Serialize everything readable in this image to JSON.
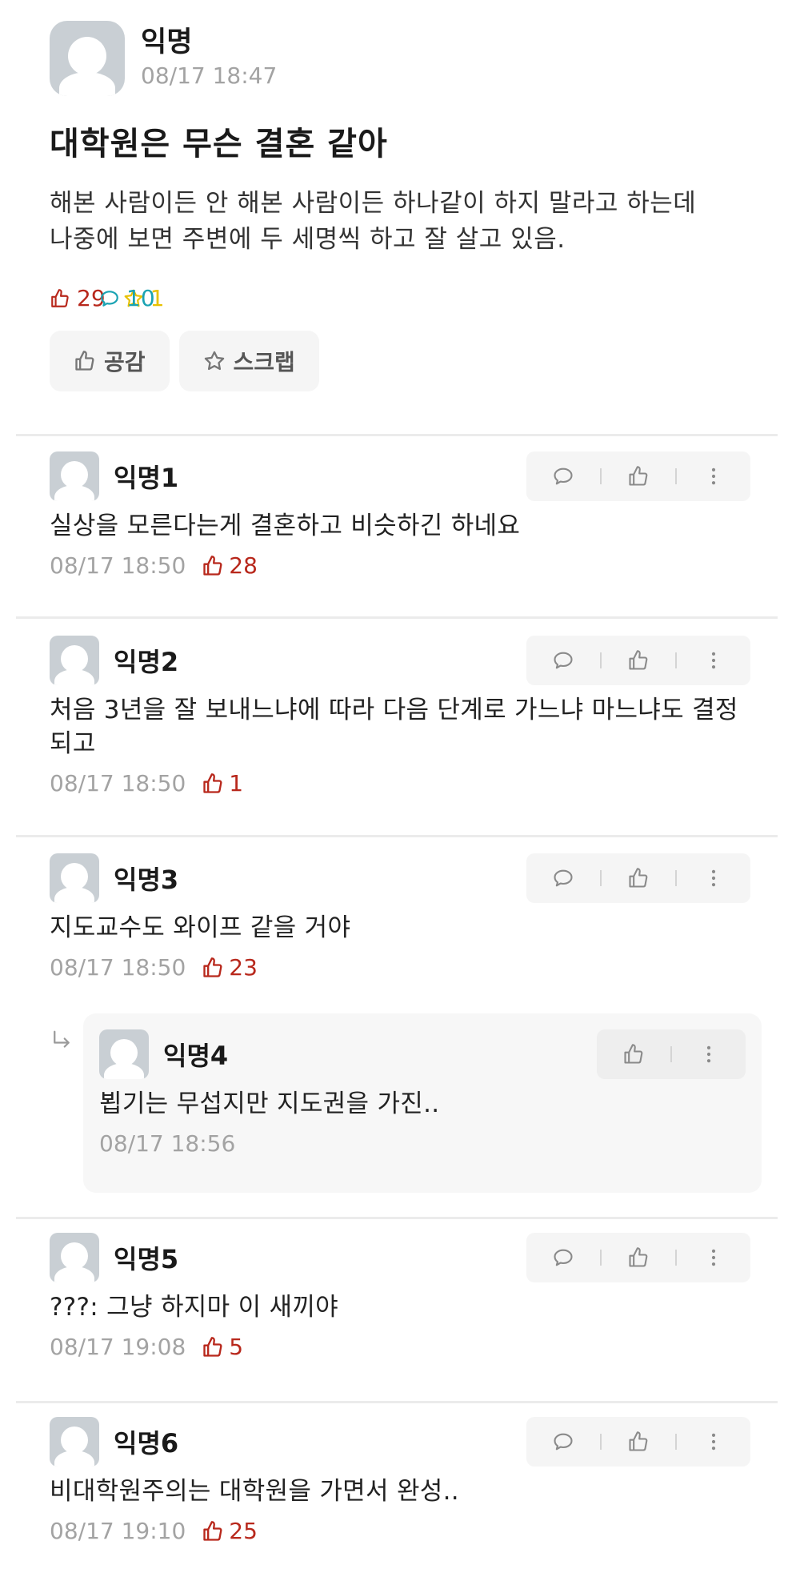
{
  "post": {
    "author": "익명",
    "time": "08/17 18:47",
    "title": "대학원은 무슨 결혼 같아",
    "body": "해본 사람이든 안 해본 사람이든 하나같이 하지 말라고 하는데\n나중에 보면 주변에 두 세명씩 하고 잘 살고 있음.",
    "likes": "29",
    "comments": "10",
    "scraps": "1",
    "like_button": "공감",
    "scrap_button": "스크랩"
  },
  "colors": {
    "like": "#b8281c",
    "comment": "#1aa3b3",
    "scrap": "#e8c100",
    "timestamp": "#a3a3a3"
  },
  "comments": [
    {
      "author": "익명1",
      "text": "실상을 모른다는게 결혼하고 비슷하긴 하네요",
      "time": "08/17 18:50",
      "likes": "28"
    },
    {
      "author": "익명2",
      "text": "처음 3년을 잘 보내느냐에 따라 다음 단계로 가느냐 마느냐도 결정되고",
      "time": "08/17 18:50",
      "likes": "1"
    },
    {
      "author": "익명3",
      "text": "지도교수도 와이프 같을 거야",
      "time": "08/17 18:50",
      "likes": "23"
    },
    {
      "author": "익명5",
      "text": "???: 그냥 하지마 이 새끼야",
      "time": "08/17 19:08",
      "likes": "5"
    },
    {
      "author": "익명6",
      "text": "비대학원주의는 대학원을 가면서 완성..",
      "time": "08/17 19:10",
      "likes": "25"
    }
  ],
  "reply": {
    "author": "익명4",
    "text": "뵙기는 무섭지만 지도권을 가진..",
    "time": "08/17 18:56"
  },
  "icons": [
    "thumbs-up-icon",
    "speech-bubble-icon",
    "star-icon",
    "more-vertical-icon",
    "reply-arrow-icon"
  ]
}
